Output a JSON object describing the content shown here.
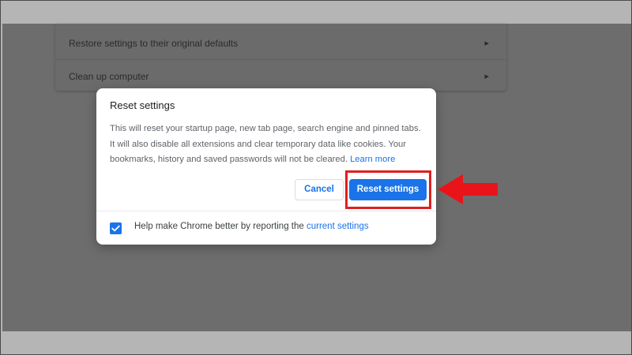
{
  "settings_list": {
    "items": [
      {
        "label": "Restore settings to their original defaults"
      },
      {
        "label": "Clean up computer"
      }
    ]
  },
  "dialog": {
    "title": "Reset settings",
    "body_text": "This will reset your startup page, new tab page, search engine and pinned tabs. It will also disable all extensions and clear temporary data like cookies. Your bookmarks, history and saved passwords will not be cleared. ",
    "learn_more": "Learn more",
    "cancel_label": "Cancel",
    "reset_label": "Reset settings",
    "checkbox": {
      "checked": true,
      "label_prefix": "Help make Chrome better by reporting the ",
      "label_link": "current settings"
    }
  },
  "annotation": {
    "highlight_color": "#e02020",
    "arrow_color": "#e8141a",
    "target": "reset-settings-button"
  },
  "colors": {
    "accent": "#1a73e8",
    "overlay": "#6d6d6d"
  }
}
